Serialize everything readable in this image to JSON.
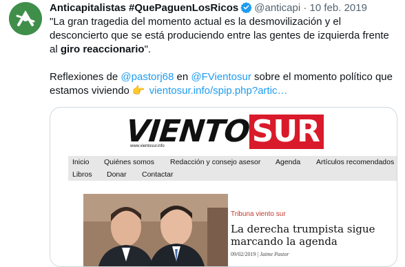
{
  "tweet": {
    "display_name": "Anticapitalistas #QuePaguenLosRicos",
    "handle": "@anticapi",
    "separator": "·",
    "date": "10 feb. 2019",
    "p1_a": "\"La gran tragedia del momento actual es la desmovilización y el desconcierto que se está produciendo entre las gentes de izquierda frente al ",
    "p1_bold": "giro reaccionario",
    "p1_end": "\".",
    "p2_a": "Reflexiones de ",
    "mention1": "@pastorj68",
    "p2_b": " en ",
    "mention2": "@FVientosur",
    "p2_c": " sobre el momento político que estamos viviendo",
    "emoji": "👉",
    "link": "vientosur.info/spip.php?artic…"
  },
  "card": {
    "logo_a": "VIENTO",
    "logo_b": "SUR",
    "logo_url": "www.vientosur.info",
    "nav_row1": [
      "Inicio",
      "Quiénes somos",
      "Redacción y consejo asesor",
      "Agenda",
      "Artículos recomendados"
    ],
    "nav_row2": [
      "Libros",
      "Donar",
      "Contactar"
    ],
    "section": "Tribuna viento sur",
    "headline": "La derecha trumpista sigue marcando la agenda",
    "date": "09/02/2019",
    "byline_sep": " | ",
    "author": "Jaime Pastor"
  },
  "colors": {
    "link": "#1d9bf0",
    "logo_red": "#d91a2a",
    "verified": "#1d9bf0"
  }
}
